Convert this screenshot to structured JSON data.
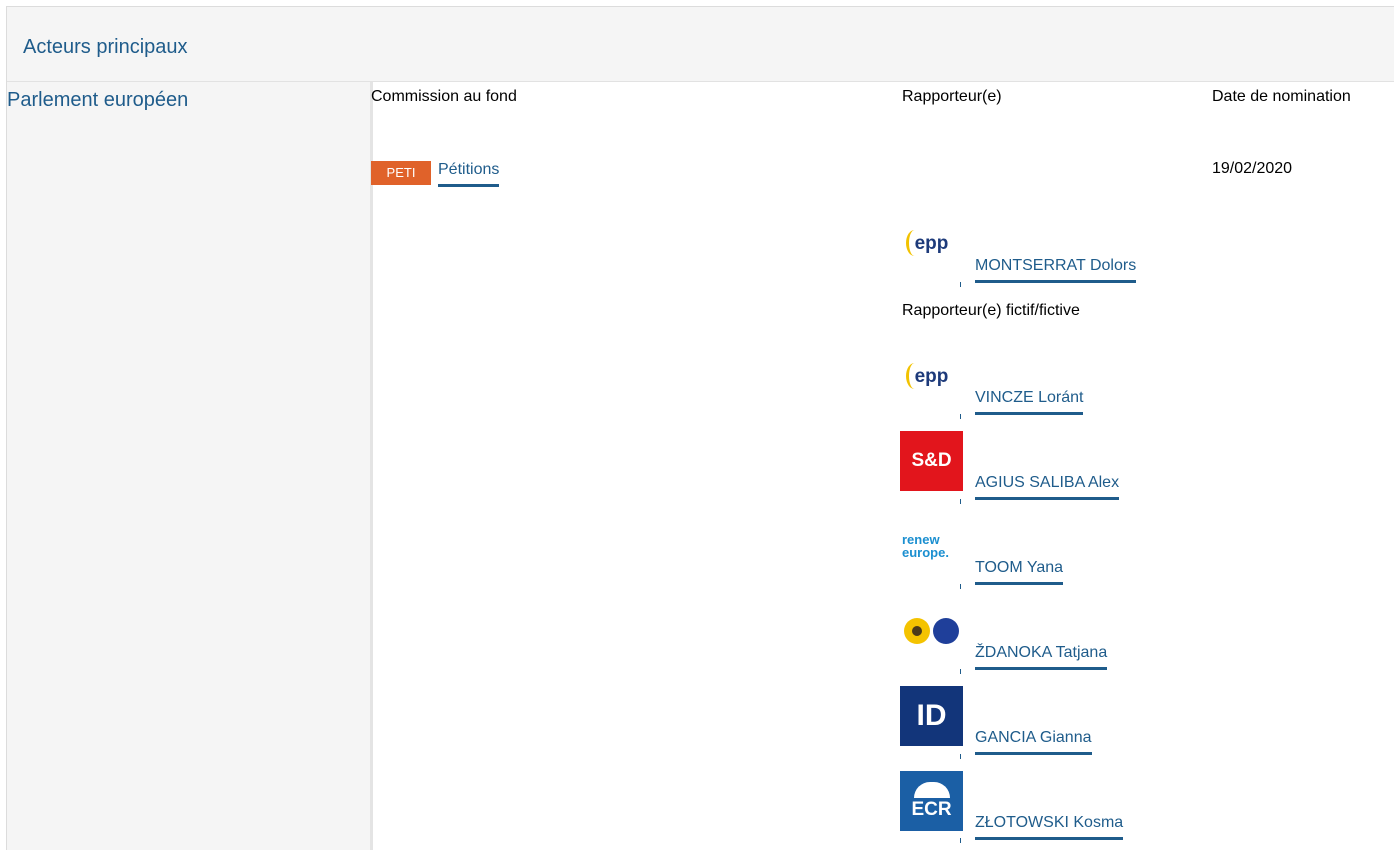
{
  "header": {
    "title": "Acteurs principaux"
  },
  "institution": "Parlement européen",
  "columns": {
    "committee": "Commission au fond",
    "rapporteur": "Rapporteur(e)",
    "nomination": "Date de nomination"
  },
  "committee": {
    "code": "PETI",
    "name": "Pétitions",
    "date": "19/02/2020"
  },
  "rapporteur": {
    "name": "MONTSERRAT Dolors",
    "group_logo": "epp-logo"
  },
  "shadow_label": "Rapporteur(e) fictif/fictive",
  "shadows": [
    {
      "name": "VINCZE Loránt",
      "group_logo": "epp-logo"
    },
    {
      "name": "AGIUS SALIBA Alex",
      "group_logo": "sd-logo"
    },
    {
      "name": "TOOM Yana",
      "group_logo": "renew-europe-logo"
    },
    {
      "name": "ŽDANOKA Tatjana",
      "group_logo": "greens-efa-logo"
    },
    {
      "name": "GANCIA Gianna",
      "group_logo": "id-logo"
    },
    {
      "name": "ZŁOTOWSKI Kosma",
      "group_logo": "ecr-logo"
    }
  ],
  "logo_text": {
    "epp": "epp",
    "sd": "S&D",
    "renew_1": "renew",
    "renew_2": "europe.",
    "id": "ID",
    "ecr": "ECR"
  },
  "colors": {
    "link": "#1f5c8b",
    "tag": "#e0622a",
    "sd": "#e2151c",
    "ecr": "#1b5fa5",
    "id": "#12357a"
  }
}
